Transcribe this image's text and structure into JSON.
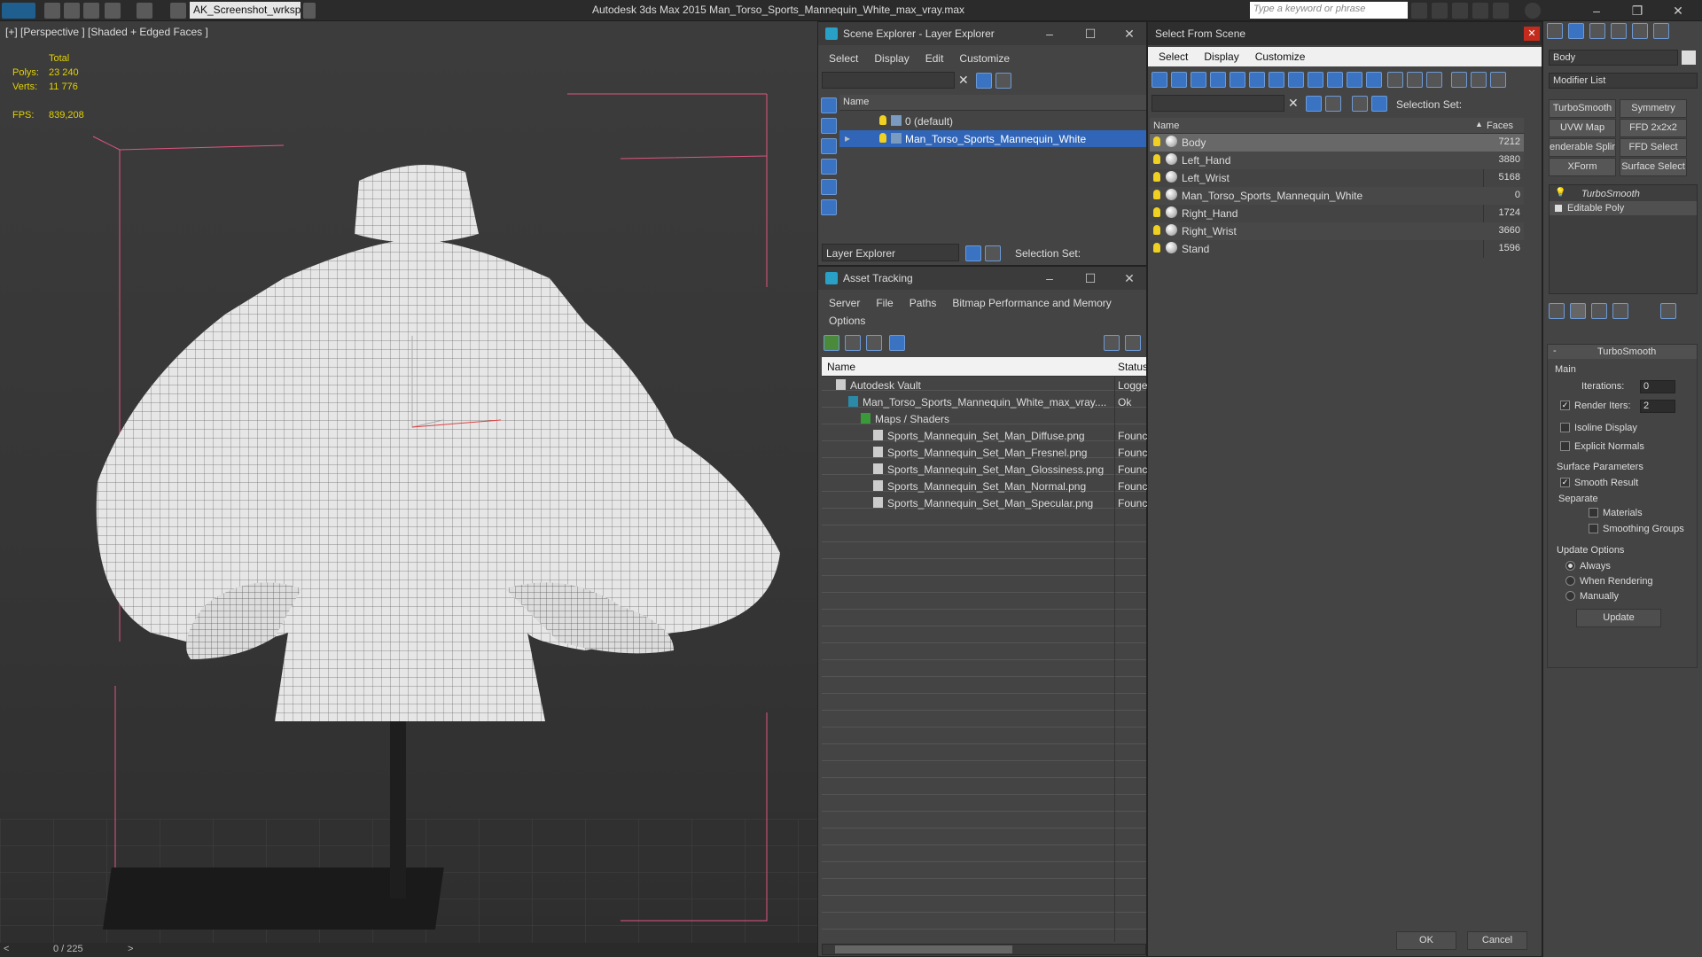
{
  "app": {
    "title": "Autodesk 3ds Max  2015    Man_Torso_Sports_Mannequin_White_max_vray.max",
    "workspace": "AK_Screenshot_wrksp",
    "search_placeholder": "Type a keyword or phrase"
  },
  "viewport": {
    "label": "[+] [Perspective ] [Shaded + Edged Faces ]",
    "stats": {
      "total": "Total",
      "polys_label": "Polys:",
      "polys": "23 240",
      "verts_label": "Verts:",
      "verts": "11 776",
      "fps_label": "FPS:",
      "fps": "839,208"
    },
    "timeline": "0 / 225"
  },
  "scene_explorer": {
    "title": "Scene Explorer - Layer Explorer",
    "menu": [
      "Select",
      "Display",
      "Edit",
      "Customize"
    ],
    "column": "Name",
    "layers": [
      "0 (default)",
      "Man_Torso_Sports_Mannequin_White"
    ],
    "footer_dropdown": "Layer Explorer",
    "selection_set": "Selection Set:"
  },
  "asset_tracking": {
    "title": "Asset Tracking",
    "menu": [
      "Server",
      "File",
      "Paths",
      "Bitmap Performance and Memory"
    ],
    "menu2": "Options",
    "columns": [
      "Name",
      "Status"
    ],
    "rows": [
      {
        "name": "Autodesk Vault",
        "status": "Logge"
      },
      {
        "name": "Man_Torso_Sports_Mannequin_White_max_vray....",
        "status": "Ok"
      },
      {
        "name": "Maps / Shaders",
        "status": ""
      },
      {
        "name": "Sports_Mannequin_Set_Man_Diffuse.png",
        "status": "Founc"
      },
      {
        "name": "Sports_Mannequin_Set_Man_Fresnel.png",
        "status": "Founc"
      },
      {
        "name": "Sports_Mannequin_Set_Man_Glossiness.png",
        "status": "Founc"
      },
      {
        "name": "Sports_Mannequin_Set_Man_Normal.png",
        "status": "Founc"
      },
      {
        "name": "Sports_Mannequin_Set_Man_Specular.png",
        "status": "Founc"
      }
    ]
  },
  "select_from_scene": {
    "title": "Select From Scene",
    "menu": [
      "Select",
      "Display",
      "Customize"
    ],
    "selection_set": "Selection Set:",
    "columns": [
      "Name",
      "Faces"
    ],
    "rows": [
      {
        "name": "Body",
        "faces": "7212"
      },
      {
        "name": "Left_Hand",
        "faces": "3880"
      },
      {
        "name": "Left_Wrist",
        "faces": "5168"
      },
      {
        "name": "Man_Torso_Sports_Mannequin_White",
        "faces": "0"
      },
      {
        "name": "Right_Hand",
        "faces": "1724"
      },
      {
        "name": "Right_Wrist",
        "faces": "3660"
      },
      {
        "name": "Stand",
        "faces": "1596"
      }
    ],
    "ok": "OK",
    "cancel": "Cancel"
  },
  "command_panel": {
    "object_name": "Body",
    "modifier_list": "Modifier List",
    "buttons": [
      "TurboSmooth",
      "Symmetry",
      "UVW Map",
      "FFD 2x2x2",
      "enderable Splir",
      "FFD Select",
      "XForm",
      "Surface Select"
    ],
    "stack": [
      "TurboSmooth",
      "Editable Poly"
    ],
    "rollout_title": "TurboSmooth",
    "main": "Main",
    "iterations_label": "Iterations:",
    "iterations": "0",
    "render_iters_label": "Render Iters:",
    "render_iters": "2",
    "isoline": "Isoline Display",
    "explicit_normals": "Explicit Normals",
    "surface_params": "Surface Parameters",
    "smooth_result": "Smooth Result",
    "separate": "Separate",
    "materials": "Materials",
    "smoothing_groups": "Smoothing Groups",
    "update_options": "Update Options",
    "always": "Always",
    "when_rendering": "When Rendering",
    "manually": "Manually",
    "update": "Update"
  }
}
